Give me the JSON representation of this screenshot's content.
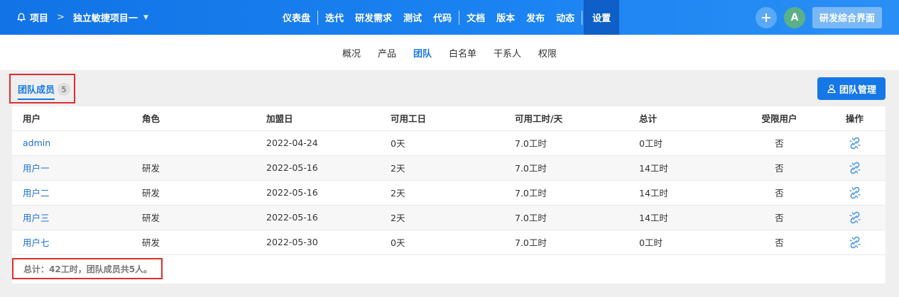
{
  "topbar": {
    "breadcrumb_root": "项目",
    "breadcrumb_separator": ">",
    "project_name": "独立敏捷项目一",
    "nav": [
      "仪表盘",
      "迭代",
      "研发需求",
      "测试",
      "代码",
      "文档",
      "版本",
      "发布",
      "动态",
      "设置"
    ],
    "active_nav": "设置",
    "avatar_letter": "A",
    "app_button": "研发综合界面"
  },
  "subnav": {
    "items": [
      "概况",
      "产品",
      "团队",
      "白名单",
      "干系人",
      "权限"
    ],
    "active": "团队"
  },
  "section": {
    "title": "团队成员",
    "count": "5",
    "manage_button": "团队管理"
  },
  "table": {
    "headers": [
      "用户",
      "角色",
      "加盟日",
      "可用工日",
      "可用工时/天",
      "总计",
      "受限用户",
      "操作"
    ],
    "rows": [
      {
        "user": "admin",
        "role": "",
        "join_date": "2022-04-24",
        "days": "0天",
        "hours_per_day": "7.0工时",
        "total": "0工时",
        "restricted": "否"
      },
      {
        "user": "用户一",
        "role": "研发",
        "join_date": "2022-05-16",
        "days": "2天",
        "hours_per_day": "7.0工时",
        "total": "14工时",
        "restricted": "否"
      },
      {
        "user": "用户二",
        "role": "研发",
        "join_date": "2022-05-16",
        "days": "2天",
        "hours_per_day": "7.0工时",
        "total": "14工时",
        "restricted": "否"
      },
      {
        "user": "用户三",
        "role": "研发",
        "join_date": "2022-05-16",
        "days": "2天",
        "hours_per_day": "7.0工时",
        "total": "14工时",
        "restricted": "否"
      },
      {
        "user": "用户七",
        "role": "研发",
        "join_date": "2022-05-30",
        "days": "0天",
        "hours_per_day": "7.0工时",
        "total": "0工时",
        "restricted": "否"
      }
    ],
    "summary": "总计：42工时，团队成员共5人。"
  },
  "colors": {
    "primary": "#1677e6",
    "highlight_border": "#e22d2d"
  }
}
